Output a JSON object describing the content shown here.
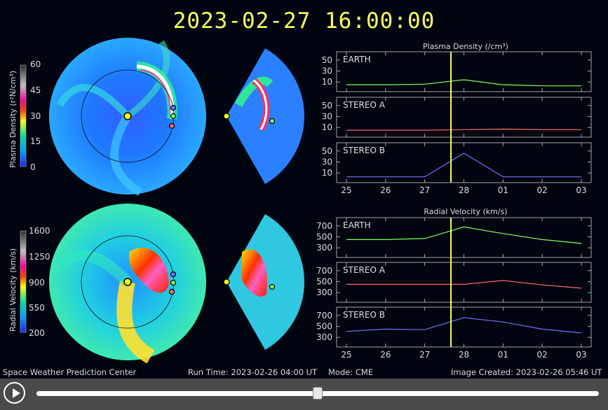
{
  "title": "2023-02-27  16:00:00",
  "colors": {
    "accent_yellow": "#ffff5a",
    "earth": "#7cff5a",
    "stereo_a": "#ff6a6a",
    "stereo_b": "#7070ff"
  },
  "left_panels": {
    "density_colorbar": {
      "label": "Plasma Density (r²N/cm³)",
      "ticks": [
        "60",
        "45",
        "30",
        "15",
        "0"
      ]
    },
    "velocity_colorbar": {
      "label": "Radial Velocity (km/s)",
      "ticks": [
        "1600",
        "1250",
        "900",
        "550",
        "200"
      ]
    }
  },
  "density_panel": {
    "title": "Plasma Density (/cm³)",
    "rows": [
      {
        "label": "EARTH",
        "ticks": [
          "50",
          "30",
          "10"
        ]
      },
      {
        "label": "STEREO A",
        "ticks": [
          "50",
          "30",
          "10"
        ]
      },
      {
        "label": "STEREO B",
        "ticks": [
          "50",
          "30",
          "10"
        ]
      }
    ]
  },
  "velocity_panel": {
    "title": "Radial Velocity (km/s)",
    "rows": [
      {
        "label": "EARTH",
        "ticks": [
          "700",
          "500",
          "300"
        ]
      },
      {
        "label": "STEREO A",
        "ticks": [
          "700",
          "500",
          "300"
        ]
      },
      {
        "label": "STEREO B",
        "ticks": [
          "700",
          "500",
          "300"
        ]
      }
    ]
  },
  "x_ticks": [
    "25",
    "26",
    "27",
    "28",
    "01",
    "02",
    "03"
  ],
  "current_time_marker": "2023-02-27 16:00",
  "chart_data": [
    {
      "type": "line",
      "title": "Plasma Density (/cm³)",
      "x": [
        "25",
        "26",
        "27",
        "28",
        "01",
        "02",
        "03"
      ],
      "ylim": [
        0,
        60
      ],
      "series": [
        {
          "name": "EARTH",
          "values": [
            5,
            5,
            6,
            14,
            5,
            3,
            3
          ]
        },
        {
          "name": "STEREO A",
          "values": [
            5,
            5,
            5,
            6,
            7,
            6,
            6
          ]
        },
        {
          "name": "STEREO B",
          "values": [
            3,
            3,
            3,
            46,
            3,
            3,
            3
          ]
        }
      ]
    },
    {
      "type": "line",
      "title": "Radial Velocity (km/s)",
      "x": [
        "25",
        "26",
        "27",
        "28",
        "01",
        "02",
        "03"
      ],
      "ylim": [
        200,
        800
      ],
      "series": [
        {
          "name": "EARTH",
          "values": [
            450,
            450,
            470,
            680,
            560,
            450,
            380
          ]
        },
        {
          "name": "STEREO A",
          "values": [
            450,
            450,
            450,
            450,
            520,
            440,
            380
          ]
        },
        {
          "name": "STEREO B",
          "values": [
            410,
            450,
            440,
            660,
            580,
            450,
            380
          ]
        }
      ]
    }
  ],
  "footer": {
    "center": "Space Weather Prediction Center",
    "run_time": "Run Time: 2023-02-26 04:00 UT",
    "mode": "Mode: CME",
    "created": "Image Created: 2023-02-26 05:46 UT"
  },
  "player": {
    "progress": 0.5
  }
}
